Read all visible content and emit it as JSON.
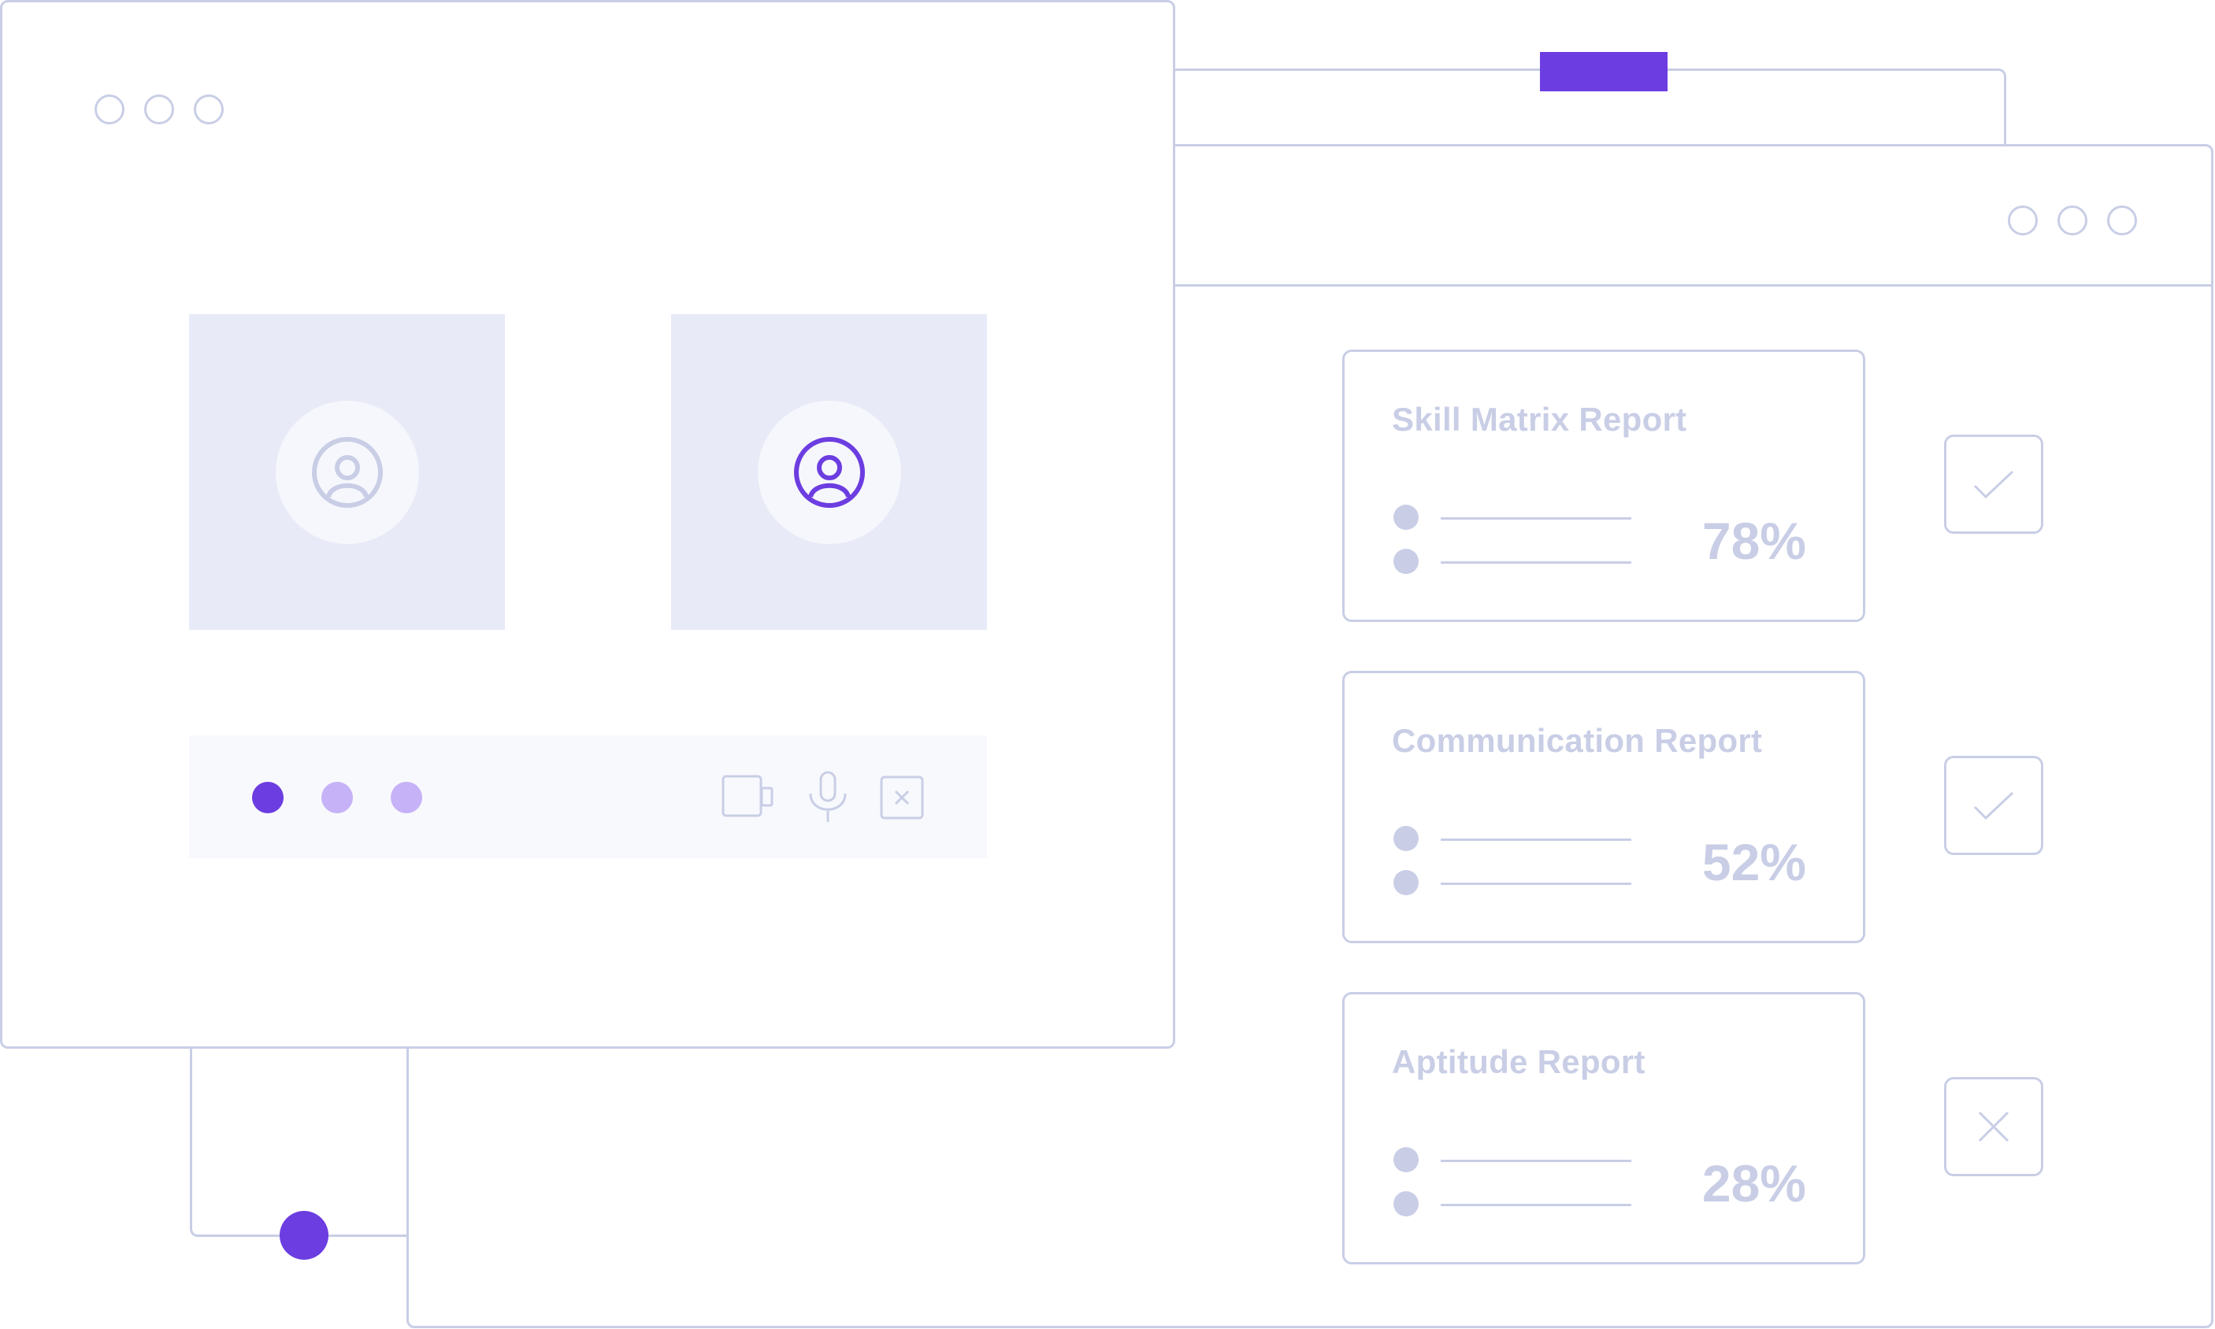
{
  "colors": {
    "outline": "#c9cee6",
    "accent": "#6c3de0",
    "accent_light": "#c6b2f7",
    "tile_bg": "#e8eaf7",
    "bar_bg": "#f8f9fd"
  },
  "video_call": {
    "window_controls": [
      "circle",
      "circle",
      "circle"
    ],
    "participants": [
      {
        "icon": "user-icon",
        "active": false
      },
      {
        "icon": "user-icon",
        "active": true
      }
    ],
    "control_bar": {
      "status_dots": [
        "accent",
        "accent_light",
        "accent_light"
      ],
      "icons": [
        "video-camera-icon",
        "microphone-icon",
        "end-call-icon"
      ]
    }
  },
  "report_window": {
    "window_controls": [
      "circle",
      "circle",
      "circle"
    ],
    "reports": [
      {
        "title": "Skill Matrix Report",
        "percent": "78%",
        "status": "check-icon"
      },
      {
        "title": "Communication Report",
        "percent": "52%",
        "status": "check-icon"
      },
      {
        "title": "Aptitude Report",
        "percent": "28%",
        "status": "cross-icon"
      }
    ]
  }
}
